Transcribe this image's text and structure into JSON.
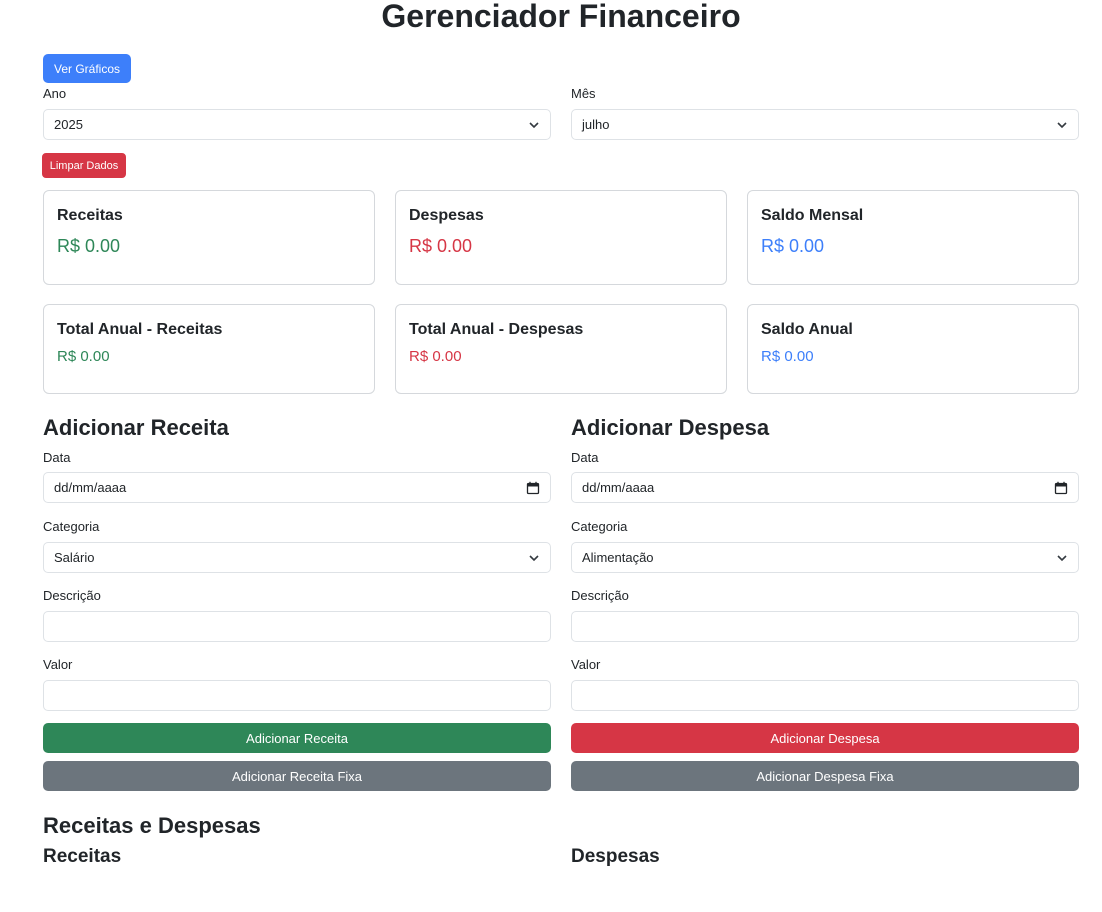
{
  "header": {
    "title": "Gerenciador Financeiro",
    "charts_button": "Ver Gráficos"
  },
  "filters": {
    "year_label": "Ano",
    "year_value": "2025",
    "month_label": "Mês",
    "month_value": "julho",
    "clear_button": "Limpar Dados"
  },
  "summary": {
    "monthly": [
      {
        "title": "Receitas",
        "amount": "R$ 0.00"
      },
      {
        "title": "Despesas",
        "amount": "R$ 0.00"
      },
      {
        "title": "Saldo Mensal",
        "amount": "R$ 0.00"
      }
    ],
    "annual": [
      {
        "title": "Total Anual - Receitas",
        "amount": "R$ 0.00"
      },
      {
        "title": "Total Anual - Despesas",
        "amount": "R$ 0.00"
      },
      {
        "title": "Saldo Anual",
        "amount": "R$ 0.00"
      }
    ]
  },
  "income_form": {
    "heading": "Adicionar Receita",
    "date_label": "Data",
    "date_placeholder": "dd/mm/aaaa",
    "category_label": "Categoria",
    "category_value": "Salário",
    "description_label": "Descrição",
    "description_value": "",
    "value_label": "Valor",
    "value_value": "",
    "submit_button": "Adicionar Receita",
    "fixed_button": "Adicionar Receita Fixa"
  },
  "expense_form": {
    "heading": "Adicionar Despesa",
    "date_label": "Data",
    "date_placeholder": "dd/mm/aaaa",
    "category_label": "Categoria",
    "category_value": "Alimentação",
    "description_label": "Descrição",
    "description_value": "",
    "value_label": "Valor",
    "value_value": "",
    "submit_button": "Adicionar Despesa",
    "fixed_button": "Adicionar Despesa Fixa"
  },
  "lists": {
    "heading": "Receitas e Despesas",
    "income_heading": "Receitas",
    "expense_heading": "Despesas"
  },
  "colors": {
    "primary": "#3d7ffa",
    "danger": "#d63645",
    "success": "#2e8758",
    "secondary": "#6c757d"
  },
  "icons": {
    "select_arrow": "chevron-down-icon",
    "date_picker": "calendar-icon"
  }
}
